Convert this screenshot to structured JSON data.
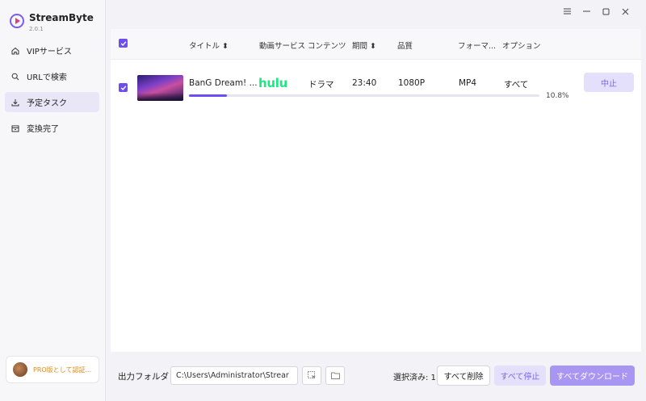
{
  "app": {
    "name": "StreamByte",
    "version": "2.0.1"
  },
  "window_controls": [
    "menu-icon",
    "minimize-icon",
    "maximize-icon",
    "close-icon"
  ],
  "sidebar": {
    "items": [
      {
        "label": "VIPサービス",
        "icon": "home-icon",
        "active": false
      },
      {
        "label": "URLで検索",
        "icon": "search-icon",
        "active": false
      },
      {
        "label": "予定タスク",
        "icon": "download-icon",
        "active": true
      },
      {
        "label": "変換完了",
        "icon": "archive-icon",
        "active": false
      }
    ],
    "pro_label": "PRO版として認証..."
  },
  "table": {
    "headers": {
      "title": "タイトル",
      "service": "動画サービス",
      "content": "コンテンツ",
      "duration": "期間",
      "quality": "品質",
      "format": "フォーマ...",
      "options": "オプション"
    },
    "rows": [
      {
        "checked": true,
        "title": "BanG Dream! ...",
        "service": "hulu",
        "content": "ドラマ",
        "duration": "23:40",
        "quality": "1080P",
        "format": "MP4",
        "options": "すべて",
        "progress": 0.108,
        "progress_text": "10.8%",
        "action": "中止"
      }
    ]
  },
  "footer": {
    "output_label": "出力フォルダ",
    "output_path": "C:\\Users\\Administrator\\Strear",
    "selected": "選択済み: 1",
    "delete_all": "すべて削除",
    "stop_all": "すべて停止",
    "download_all": "すべてダウンロード"
  },
  "colors": {
    "accent": "#6d4df0",
    "hulu": "#1ce783",
    "pro": "#e08a1e"
  }
}
